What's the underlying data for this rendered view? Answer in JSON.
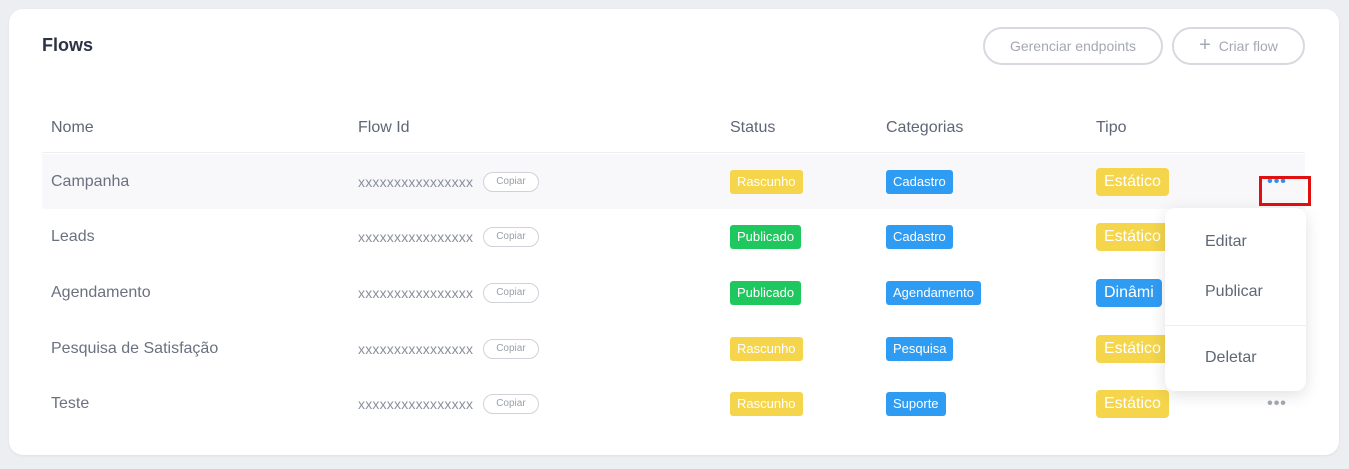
{
  "header": {
    "title": "Flows",
    "manage_endpoints_label": "Gerenciar endpoints",
    "create_flow_label": "Criar flow",
    "create_flow_icon": "plus-icon"
  },
  "table": {
    "columns": [
      "Nome",
      "Flow Id",
      "Status",
      "Categorias",
      "Tipo"
    ],
    "copy_label": "Copiar",
    "rows": [
      {
        "name": "Campanha",
        "flow_id": "xxxxxxxxxxxxxxxx",
        "status": "Rascunho",
        "category": "Cadastro",
        "type": "Estático"
      },
      {
        "name": "Leads",
        "flow_id": "xxxxxxxxxxxxxxxx",
        "status": "Publicado",
        "category": "Cadastro",
        "type": "Estático"
      },
      {
        "name": "Agendamento",
        "flow_id": "xxxxxxxxxxxxxxxx",
        "status": "Publicado",
        "category": "Agendamento",
        "type": "Dinâmi"
      },
      {
        "name": "Pesquisa de Satisfação",
        "flow_id": "xxxxxxxxxxxxxxxx",
        "status": "Rascunho",
        "category": "Pesquisa",
        "type": "Estático"
      },
      {
        "name": "Teste",
        "flow_id": "xxxxxxxxxxxxxxxx",
        "status": "Rascunho",
        "category": "Suporte",
        "type": "Estático"
      }
    ],
    "row_actions_icon": "more-horizontal-icon"
  },
  "context_menu": {
    "items": [
      "Editar",
      "Publicar",
      "Deletar"
    ]
  },
  "colors": {
    "rascunho": "#f4d54b",
    "publicado": "#1fc85e",
    "category": "#2f9cf4",
    "tipo_estatico": "#f4d54b",
    "tipo_dinamico": "#2f9cf4",
    "highlight": "#e01010"
  }
}
